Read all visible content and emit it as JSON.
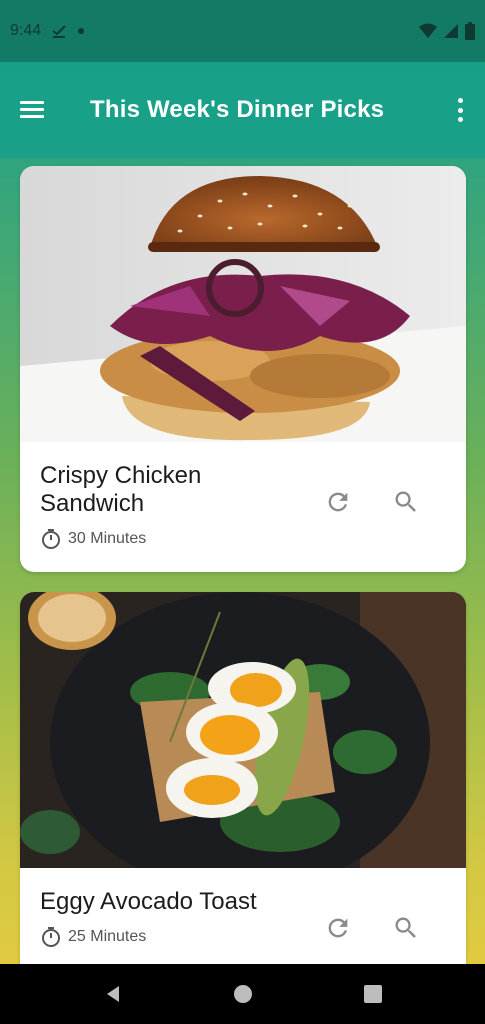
{
  "status_bar": {
    "time": "9:44"
  },
  "app_bar": {
    "title": "This Week's Dinner Picks"
  },
  "cards": [
    {
      "title": "Crispy Chicken Sandwich",
      "duration": "30 Minutes",
      "image_icon": "chicken-sandwich-photo"
    },
    {
      "title": "Eggy Avocado Toast",
      "duration": "25 Minutes",
      "image_icon": "avocado-toast-photo"
    }
  ],
  "colors": {
    "app_bar": "#1aa088",
    "status_bar": "#137a66",
    "gradient_bottom": "#e9cc3f"
  }
}
